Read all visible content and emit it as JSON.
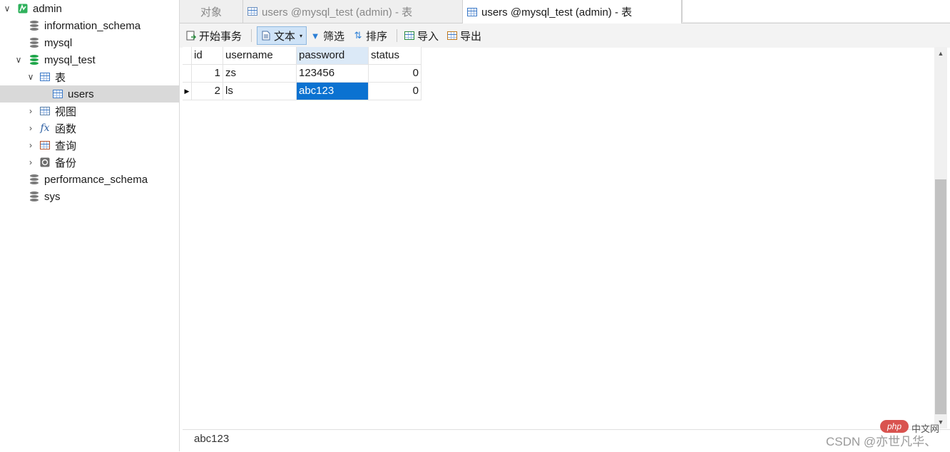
{
  "tree": {
    "connection": "admin",
    "databases": [
      {
        "name": "information_schema"
      },
      {
        "name": "mysql"
      },
      {
        "name": "mysql_test",
        "children": {
          "tables_label": "表",
          "tables": [
            "users"
          ],
          "views_label": "视图",
          "functions_label": "函数",
          "queries_label": "查询",
          "backups_label": "备份"
        }
      },
      {
        "name": "performance_schema"
      },
      {
        "name": "sys"
      }
    ]
  },
  "tabs": [
    {
      "label": "对象"
    },
    {
      "label": "users @mysql_test (admin) - 表"
    },
    {
      "label": "users @mysql_test (admin) - 表",
      "active": true
    }
  ],
  "toolbar": {
    "begin_transaction": "开始事务",
    "text": "文本",
    "filter": "筛选",
    "sort": "排序",
    "import": "导入",
    "export": "导出"
  },
  "grid": {
    "columns": [
      "id",
      "username",
      "password",
      "status"
    ],
    "rows": [
      [
        "1",
        "zs",
        "123456",
        "0"
      ],
      [
        "2",
        "ls",
        "abc123",
        "0"
      ]
    ],
    "selected_cell": {
      "row": 1,
      "column": "password"
    }
  },
  "status": {
    "value": "abc123",
    "watermark_badge": "php",
    "watermark_site": "中文网",
    "watermark_author": "CSDN @亦世凡华、"
  },
  "colors": {
    "selection": "#0b72d1",
    "header_highlight": "#dbe9f7",
    "db_active": "#1fa64a"
  }
}
